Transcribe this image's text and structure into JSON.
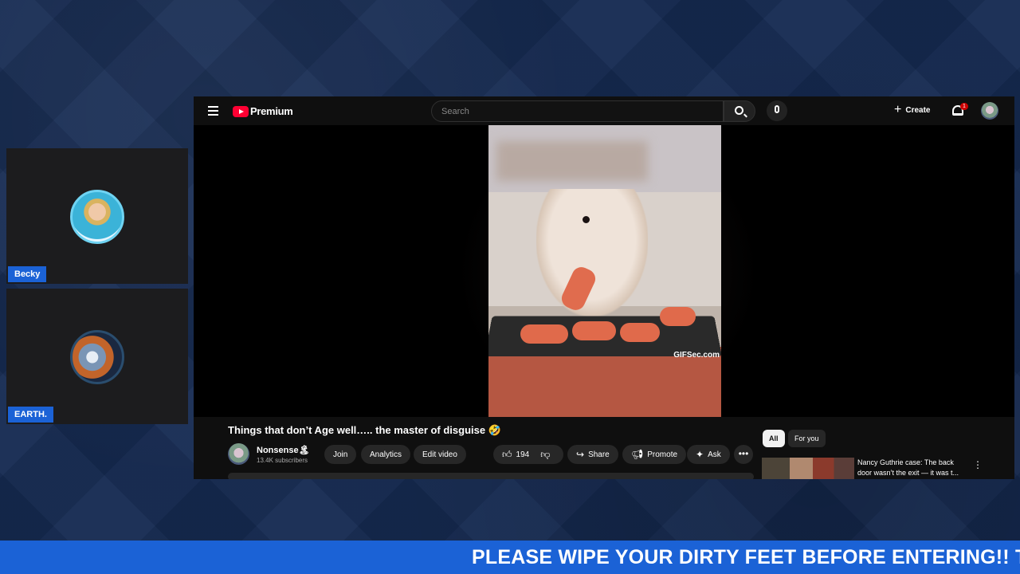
{
  "participants": [
    {
      "name": "Becky"
    },
    {
      "name": "EARTH."
    }
  ],
  "youtube": {
    "logo_text": "Premium",
    "search": {
      "placeholder": "Search"
    },
    "create_label": "Create",
    "notifications_count": "1",
    "video": {
      "watermark": "GIFSec.com",
      "title": "Things that don’t Age well….. the master of disguise 🤣",
      "channel": {
        "name": "Nonsense🏝",
        "subscribers": "13.4K subscribers"
      },
      "actions": {
        "join": "Join",
        "analytics": "Analytics",
        "edit_video": "Edit video",
        "likes": "194",
        "share": "Share",
        "promote": "Promote",
        "ask": "Ask"
      }
    },
    "sidebar": {
      "chips": [
        "All",
        "For you"
      ],
      "recommendation": {
        "title": "Nancy Guthrie case: The back door wasn’t the exit — it was t..."
      }
    }
  },
  "ticker": {
    "text": "PLEASE WIPE YOUR DIRTY FEET BEFORE ENTERING!! TH"
  },
  "colors": {
    "accent": "#1b62d6",
    "youtube_red": "#ff0033",
    "background": "#152a52"
  }
}
